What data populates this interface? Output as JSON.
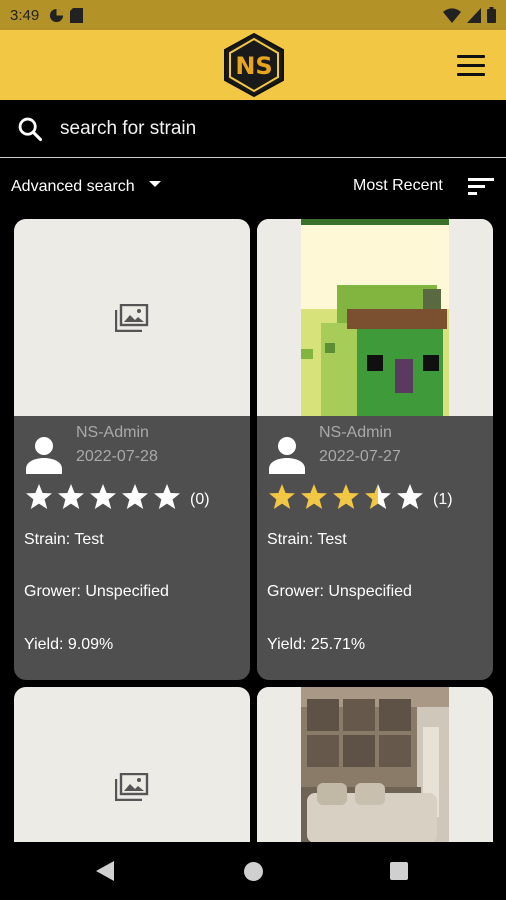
{
  "status": {
    "time": "3:49"
  },
  "search": {
    "placeholder": "search for strain"
  },
  "filters": {
    "advanced_label": "Advanced search",
    "sort_label": "Most Recent"
  },
  "posts": [
    {
      "author": "NS-Admin",
      "date": "2022-07-28",
      "rating": 0,
      "rating_count": "(0)",
      "strain": "Strain: Test",
      "grower": "Grower: Unspecified",
      "yield": "Yield: 9.09%",
      "has_image": false
    },
    {
      "author": "NS-Admin",
      "date": "2022-07-27",
      "rating": 3.5,
      "rating_count": "(1)",
      "strain": "Strain: Test",
      "grower": "Grower: Unspecified",
      "yield": "Yield: 25.71%",
      "has_image": true
    },
    {
      "has_image": false
    },
    {
      "has_image": true
    }
  ],
  "colors": {
    "accent": "#f2c744",
    "star_filled": "#f2c744",
    "star_empty": "#ffffff",
    "card": "#4f4f4f",
    "placeholder": "#edebe6"
  },
  "logo": {
    "text": "NS"
  }
}
